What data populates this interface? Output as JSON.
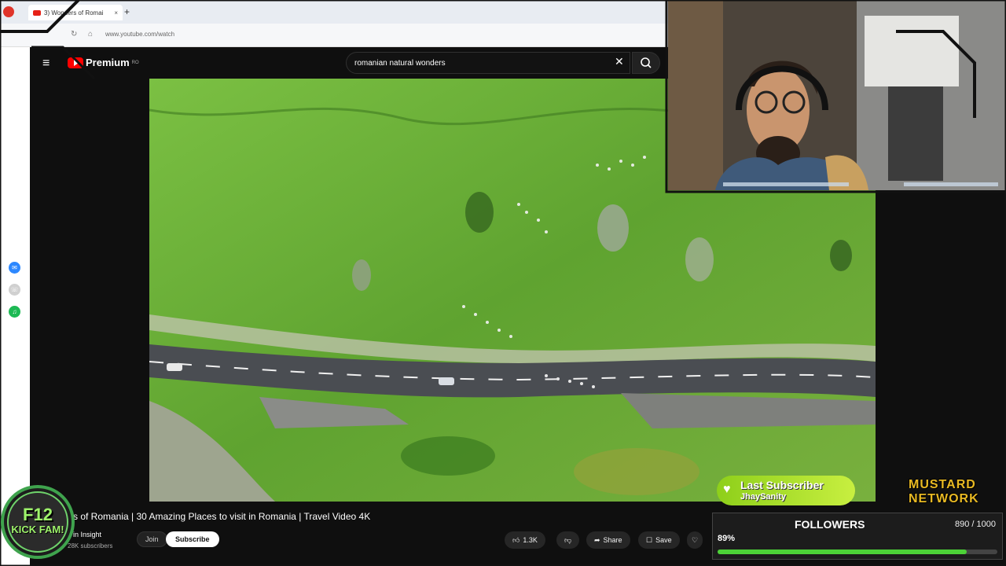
{
  "browser": {
    "tab_title": "3) Wonders of Romai",
    "new_tab": "+",
    "url": "www.youtube.com/watch"
  },
  "youtube": {
    "logo_text": "Premium",
    "logo_region": "RO",
    "search_value": "romanian natural wonders",
    "video_title": "s of Romania | 30 Amazing Places to visit in Romania | Travel Video 4K",
    "channel_name": "in Insight",
    "subscriber_count": "28K subscribers",
    "join_label": "Join",
    "subscribe_label": "Subscribe",
    "like_count": "1.3K",
    "share_label": "Share",
    "save_label": "Save"
  },
  "stream_overlay": {
    "badge_line1": "F12",
    "badge_line2": "KICK FAM!",
    "last_subscriber_title": "Last Subscriber",
    "last_subscriber_name": "JhaySanity",
    "mustard_line1": "MUSTARD",
    "mustard_line2": "NETWORK",
    "followers_title": "FOLLOWERS",
    "followers_count": "890 / 1000",
    "followers_percent": "89%",
    "followers_progress": 0.89
  },
  "dock": {
    "icons": [
      "messenger-icon",
      "whatsapp-icon",
      "spotify-icon"
    ]
  },
  "colors": {
    "youtube_red": "#ff0000",
    "bg_dark": "#0f0f0f",
    "accent_green": "#8ecf1a",
    "progress_green": "#4cd137"
  }
}
